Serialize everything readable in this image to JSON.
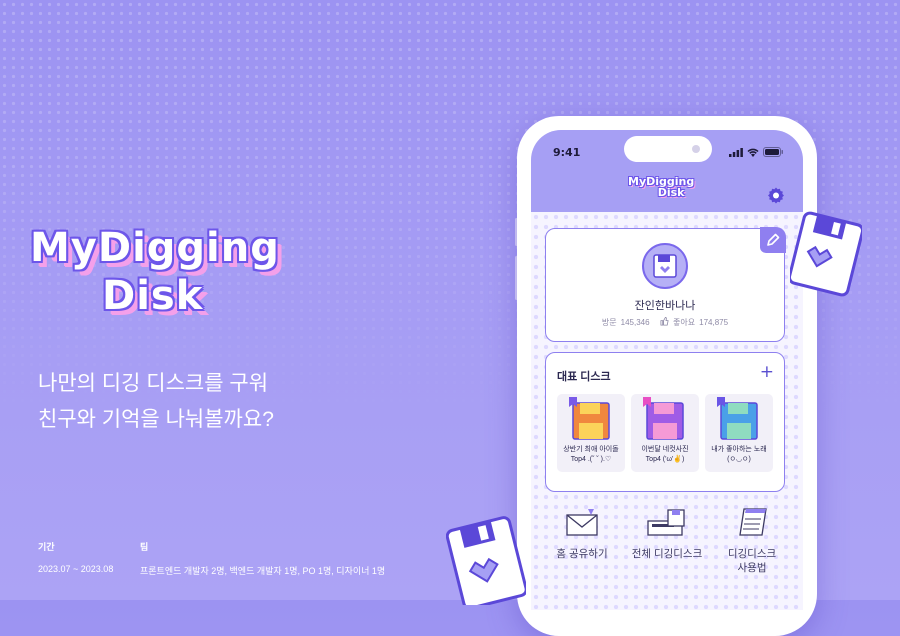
{
  "brand": {
    "logo_line1": "MyDigging",
    "logo_line2": "Disk",
    "colors": {
      "background": "#a59cf4",
      "accent": "#6d56ea",
      "shadow": "#f4a0ea"
    }
  },
  "tagline": {
    "line1": "나만의 디깅 디스크를 구워",
    "line2": "친구와 기억을 나눠볼까요?"
  },
  "info": {
    "period_label": "기간",
    "period_value": "2023.07 ~ 2023.08",
    "team_label": "팀",
    "team_value": "프론트엔드 개발자 2명, 백엔드 개발자 1명, PO 1명, 디자이너 1명"
  },
  "phone": {
    "status_time": "9:41",
    "app_logo_line1": "MyDigging",
    "app_logo_line2": "Disk",
    "icons": [
      "signal-icon",
      "wifi-icon",
      "battery-icon",
      "settings-icon",
      "edit-icon"
    ],
    "profile": {
      "name": "잔인한바나나",
      "visits_label": "방문",
      "visits": "145,346",
      "likes_label": "좋아요",
      "likes": "174,875"
    },
    "featured": {
      "title": "대표 디스크",
      "add_label": "+",
      "disks": [
        {
          "line1": "상반기 최애 아이돌",
          "line2": "Top4 .(˘ ˘ ).♡",
          "color": "#f0873e"
        },
        {
          "line1": "이번달 네컷사진",
          "line2": "Top4 ('ω'✌)",
          "color": "#a05ce6"
        },
        {
          "line1": "내가 좋아하는 노래",
          "line2": "(ㅇ◡ㅇ)",
          "color": "#4aa0e8"
        }
      ]
    },
    "menu": [
      {
        "label": "홈 공유하기",
        "label2": ""
      },
      {
        "label": "전체 디깅디스크",
        "label2": ""
      },
      {
        "label": "디깅디스크",
        "label2": "사용법"
      }
    ]
  }
}
